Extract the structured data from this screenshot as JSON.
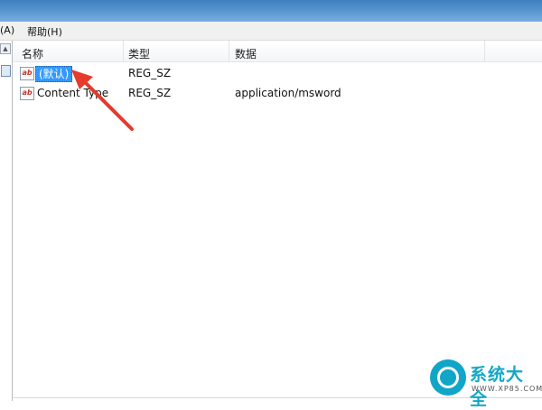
{
  "menu": {
    "partial_label": "(A)",
    "help_label": "帮助(H)"
  },
  "columns": {
    "name": "名称",
    "type": "类型",
    "data": "数据"
  },
  "rows": [
    {
      "icon": "ab",
      "name": "(默认)",
      "type": "REG_SZ",
      "data": "",
      "selected": true
    },
    {
      "icon": "ab",
      "name": "Content Type",
      "type": "REG_SZ",
      "data": "application/msword",
      "selected": false
    }
  ],
  "watermark": {
    "brand": "系统大全",
    "url": "WWW.XP85.COM"
  },
  "colors": {
    "selection": "#3399ff",
    "arrow": "#e53a2c",
    "brand": "#12a7c9"
  }
}
